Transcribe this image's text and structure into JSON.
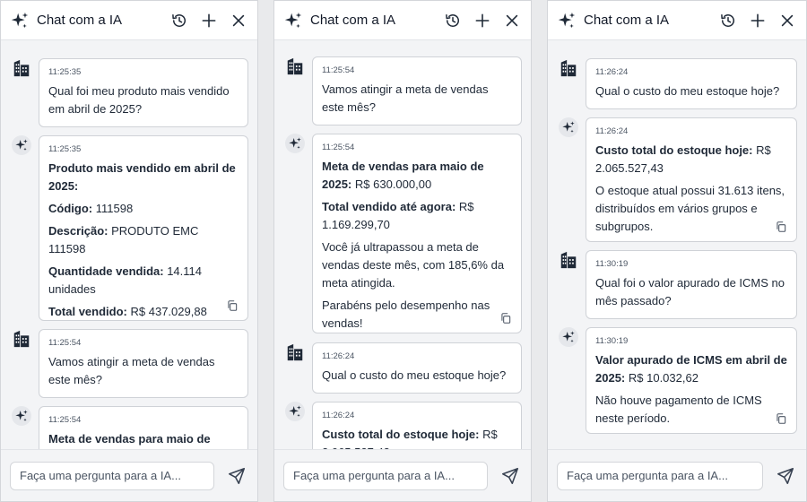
{
  "header": {
    "title": "Chat com a IA"
  },
  "footer": {
    "placeholder": "Faça uma pergunta para a IA..."
  },
  "conversation": {
    "q1": {
      "time": "11:25:35",
      "text": "Qual foi meu produto mais vendido em abril de 2025?"
    },
    "a1": {
      "time": "11:25:35",
      "title": "Produto mais vendido em abril de 2025:",
      "code_label": "Código:",
      "code_value": "111598",
      "desc_label": "Descrição:",
      "desc_value": "PRODUTO EMC 111598",
      "qty_label": "Quantidade vendida:",
      "qty_value": "14.114 unidades",
      "total_label": "Total vendido:",
      "total_value": "R$ 437.029,88"
    },
    "q2": {
      "time": "11:25:54",
      "text": "Vamos atingir a meta de vendas este mês?"
    },
    "a2": {
      "time": "11:25:54",
      "meta_label": "Meta de vendas para maio de 2025:",
      "meta_value": "R$ 630.000,00",
      "sold_label": "Total vendido até agora:",
      "sold_value": "R$ 1.169.299,70",
      "para1": "Você já ultrapassou a meta de vendas deste mês, com 185,6% da meta atingida.",
      "para2": "Parabéns pelo desempenho nas vendas!"
    },
    "q3": {
      "time": "11:26:24",
      "text": "Qual o custo do meu estoque hoje?"
    },
    "a3": {
      "time": "11:26:24",
      "cost_label": "Custo total do estoque hoje:",
      "cost_value": "R$ 2.065.527,43",
      "para": "O estoque atual possui 31.613 itens, distribuídos em vários grupos e subgrupos."
    },
    "q4": {
      "time": "11:30:19",
      "text": "Qual foi o valor apurado de ICMS no mês passado?"
    },
    "a4": {
      "time": "11:30:19",
      "icms_label": "Valor apurado de ICMS em abril de 2025:",
      "icms_value": "R$ 10.032,62",
      "para": "Não houve pagamento de ICMS neste período."
    }
  },
  "icons": [
    "sparkle-icon",
    "history-icon",
    "plus-icon",
    "close-icon",
    "building-icon",
    "copy-icon",
    "send-icon"
  ]
}
